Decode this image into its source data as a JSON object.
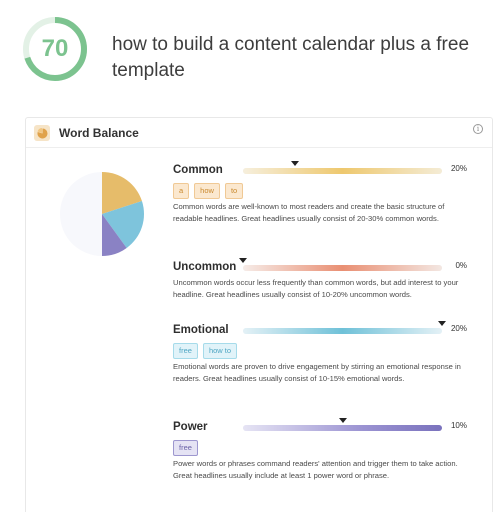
{
  "score": {
    "value": "70",
    "fraction": 0.7,
    "color": "#7cc38f",
    "track_color": "#e3f1e6"
  },
  "headline": "how to build a content calendar plus a free template",
  "card": {
    "title": "Word Balance",
    "icon": "pie-chart-icon",
    "info_icon": "info-icon"
  },
  "pie": {
    "slices": [
      {
        "name": "Common",
        "value": 20,
        "color": "#e6bc6a"
      },
      {
        "name": "Emotional",
        "value": 20,
        "color": "#7ec4dc"
      },
      {
        "name": "Power",
        "value": 10,
        "color": "#8a82c4"
      },
      {
        "name": "Rest",
        "value": 50,
        "color": "#f7f8fc"
      }
    ]
  },
  "sections": {
    "common": {
      "label": "Common",
      "percent": "20%",
      "level": 0.2,
      "marker": 0.26,
      "gradient": [
        "#f6efdd",
        "#eec86e",
        "#f4ecd6"
      ],
      "tags": [
        "a",
        "how",
        "to"
      ],
      "description": "Common words are well-known to most readers and create the basic structure of readable headlines. Great headlines usually consist of 20-30% common words."
    },
    "uncommon": {
      "label": "Uncommon",
      "percent": "0%",
      "level": 0.0,
      "marker": 0.0,
      "gradient": [
        "#f6ece8",
        "#e98f73",
        "#f3e7e2"
      ],
      "tags": [],
      "description": "Uncommon words occur less frequently than common words, but add interest to your headline. Great headlines usually consist of 10-20% uncommon words."
    },
    "emotional": {
      "label": "Emotional",
      "percent": "20%",
      "level": 0.2,
      "marker": 1.0,
      "gradient": [
        "#e4f1f6",
        "#6fc1d8",
        "#e4f1f6"
      ],
      "tags": [
        "free",
        "how to"
      ],
      "description": "Emotional words are proven to drive engagement by stirring an emotional response in readers. Great headlines usually consist of 10-15% emotional words."
    },
    "power": {
      "label": "Power",
      "percent": "10%",
      "level": 0.1,
      "marker": 0.5,
      "gradient": [
        "#e6e4f4",
        "#9b93d2",
        "#7a72bd"
      ],
      "tags": [
        "free"
      ],
      "description": "Power words or phrases command readers' attention and trigger them to take action. Great headlines usually include at least 1 power word or phrase."
    }
  }
}
